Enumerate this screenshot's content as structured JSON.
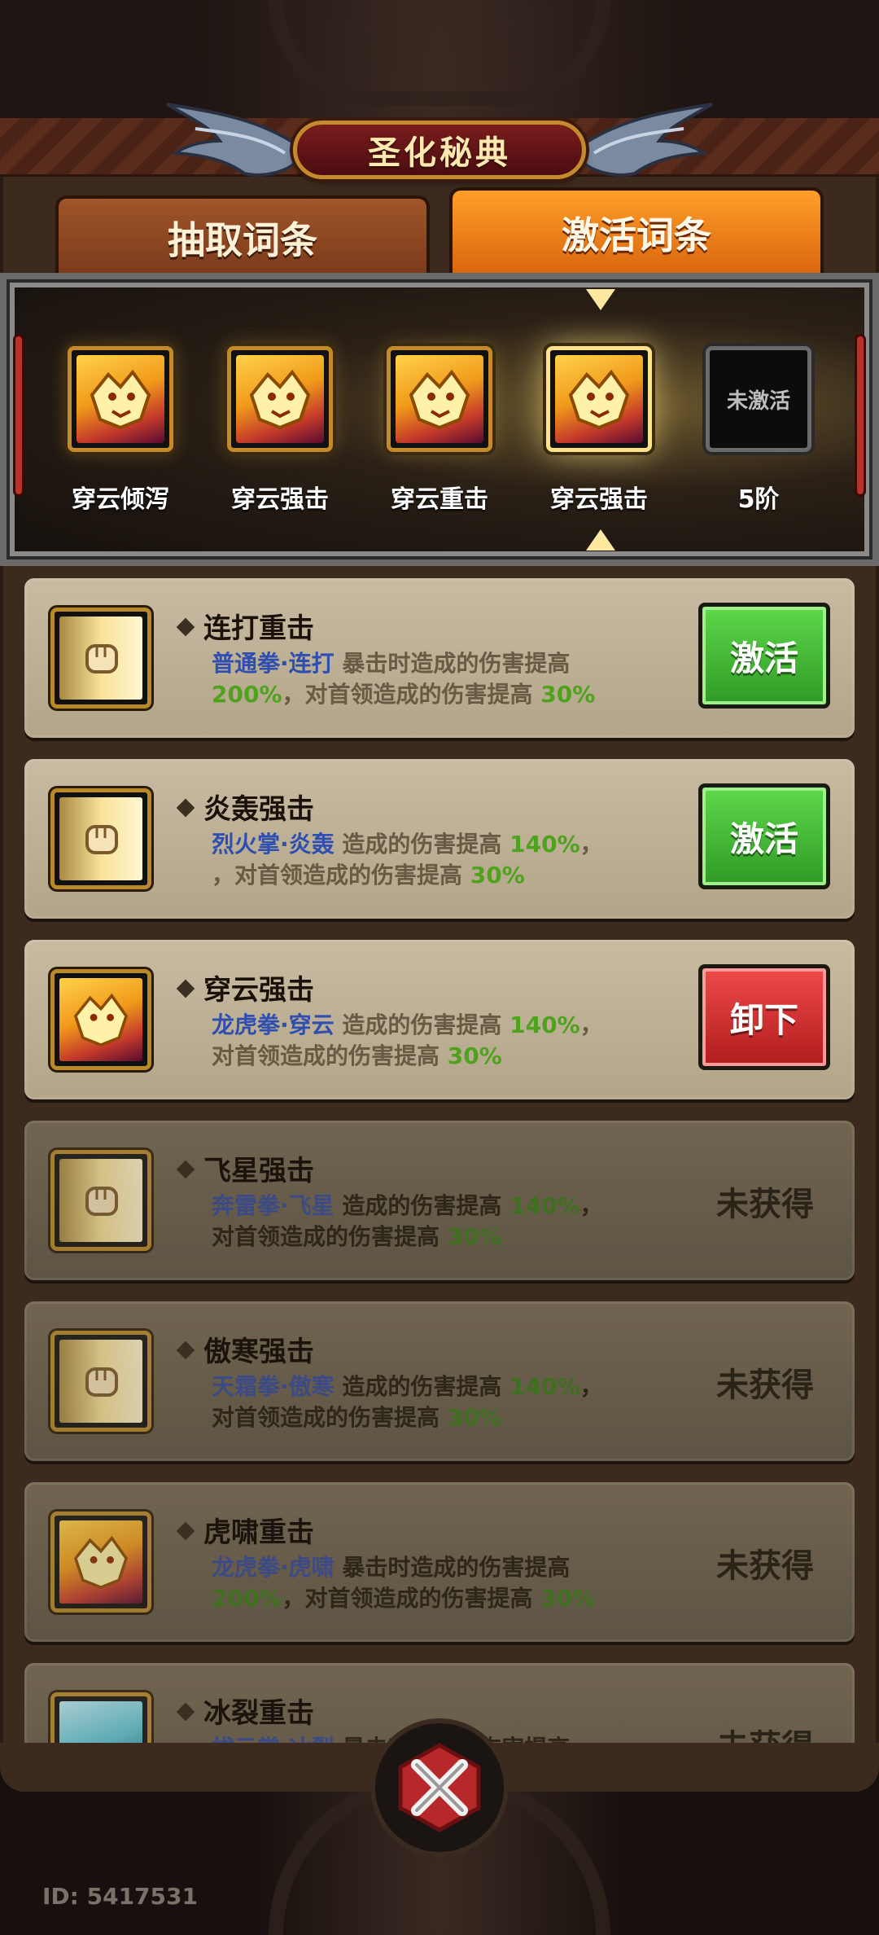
{
  "title": "圣化秘典",
  "tabs": {
    "draw": "抽取词条",
    "activate": "激活词条"
  },
  "slots": [
    {
      "label": "穿云倾泻",
      "icon": "tiger-icon"
    },
    {
      "label": "穿云强击",
      "icon": "tiger-icon"
    },
    {
      "label": "穿云重击",
      "icon": "tiger-icon"
    },
    {
      "label": "穿云强击",
      "icon": "tiger-icon"
    },
    {
      "label": "5阶",
      "placeholder": "未激活"
    }
  ],
  "cards": [
    {
      "name": "连打重击",
      "skill": "普通拳·连打",
      "text1": "暴击时造成的伤害提高",
      "pct1": "200%",
      "text2": "，对首领造成的伤害提高",
      "pct2": "30%",
      "action": "激活"
    },
    {
      "name": "炎轰强击",
      "skill": "烈火掌·炎轰",
      "text1": "造成的伤害提高",
      "pct1": "140%",
      "text2": "，对首领造成的伤害提高",
      "pct2": "30%",
      "action": "激活"
    },
    {
      "name": "穿云强击",
      "skill": "龙虎拳·穿云",
      "text1": "造成的伤害提高",
      "pct1": "140%",
      "text2": "，对首领造成的伤害提高",
      "pct2": "30%",
      "action": "卸下"
    },
    {
      "name": "飞星强击",
      "skill": "奔雷拳·飞星",
      "text1": "造成的伤害提高",
      "pct1": "140%",
      "text2": "，对首领造成的伤害提高",
      "pct2": "30%",
      "status": "未获得"
    },
    {
      "name": "傲寒强击",
      "skill": "天霜拳·傲寒",
      "text1": "造成的伤害提高",
      "pct1": "140%",
      "text2": "，对首领造成的伤害提高",
      "pct2": "30%",
      "status": "未获得"
    },
    {
      "name": "虎啸重击",
      "skill": "龙虎拳·虎啸",
      "text1": "暴击时造成的伤害提高",
      "pct1": "200%",
      "text2": "，对首领造成的伤害提高",
      "pct2": "30%",
      "status": "未获得"
    },
    {
      "name": "冰裂重击",
      "skill": "拔云掌·冰裂",
      "text1": "暴击时造成的伤害提高",
      "pct1": "",
      "text2": "",
      "pct2": "",
      "status": "未获得"
    }
  ],
  "user_id": "ID: 5417531"
}
